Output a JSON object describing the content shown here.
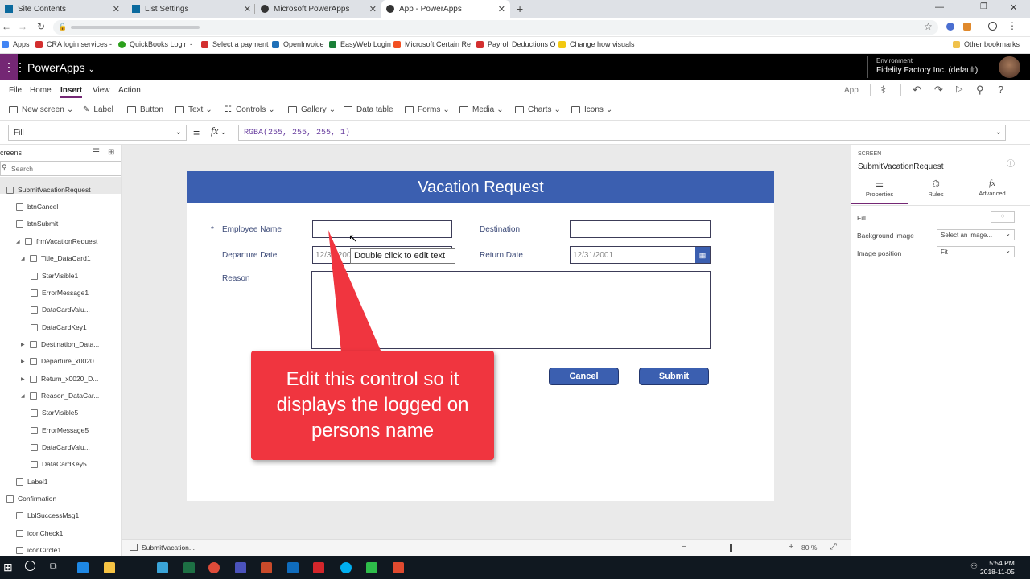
{
  "browser": {
    "tabs": [
      {
        "label": "Site Contents",
        "active": false
      },
      {
        "label": "List Settings",
        "active": false
      },
      {
        "label": "Microsoft PowerApps",
        "active": false
      },
      {
        "label": "App - PowerApps",
        "active": true
      }
    ],
    "bookmarks": [
      "Apps",
      "CRA login services -",
      "QuickBooks Login -",
      "Select a payment",
      "OpenInvoice",
      "EasyWeb Login",
      "Microsoft Certain Re",
      "Payroll Deductions O",
      "Change how visuals"
    ],
    "other_bookmarks": "Other bookmarks"
  },
  "header": {
    "app_name": "PowerApps",
    "env_label": "Environment",
    "env_name": "Fidelity Factory Inc. (default)"
  },
  "menu": {
    "items": [
      "File",
      "Home",
      "Insert",
      "View",
      "Action"
    ],
    "active": "Insert",
    "app_label": "App"
  },
  "toolbar": [
    "New screen",
    "Label",
    "Button",
    "Text",
    "Controls",
    "Gallery",
    "Data table",
    "Forms",
    "Media",
    "Charts",
    "Icons"
  ],
  "formula": {
    "property": "Fill",
    "equals": "=",
    "fx": "fx",
    "value": "RGBA(255, 255, 255, 1)"
  },
  "tree": {
    "title": "creens",
    "search_placeholder": "Search",
    "nodes": [
      {
        "label": "SubmitVacationRequest",
        "depth": 0,
        "selected": true
      },
      {
        "label": "btnCancel",
        "depth": 1
      },
      {
        "label": "btnSubmit",
        "depth": 1
      },
      {
        "label": "frmVacationRequest",
        "depth": 1,
        "expanded": true
      },
      {
        "label": "Title_DataCard1",
        "depth": 2,
        "expanded": true
      },
      {
        "label": "StarVisible1",
        "depth": 3
      },
      {
        "label": "ErrorMessage1",
        "depth": 3
      },
      {
        "label": "DataCardValu...",
        "depth": 3
      },
      {
        "label": "DataCardKey1",
        "depth": 3
      },
      {
        "label": "Destination_Data...",
        "depth": 2
      },
      {
        "label": "Departure_x0020...",
        "depth": 2
      },
      {
        "label": "Return_x0020_D...",
        "depth": 2
      },
      {
        "label": "Reason_DataCar...",
        "depth": 2,
        "expanded": true
      },
      {
        "label": "StarVisible5",
        "depth": 3
      },
      {
        "label": "ErrorMessage5",
        "depth": 3
      },
      {
        "label": "DataCardValu...",
        "depth": 3
      },
      {
        "label": "DataCardKey5",
        "depth": 3
      },
      {
        "label": "Label1",
        "depth": 1
      },
      {
        "label": "Confirmation",
        "depth": 0
      },
      {
        "label": "LblSuccessMsg1",
        "depth": 1
      },
      {
        "label": "iconCheck1",
        "depth": 1
      },
      {
        "label": "iconCircle1",
        "depth": 1
      }
    ]
  },
  "form": {
    "title": "Vacation Request",
    "required_star": "*",
    "employee_name_label": "Employee Name",
    "destination_label": "Destination",
    "departure_label": "Departure Date",
    "departure_value": "12/31/200",
    "return_label": "Return Date",
    "return_value": "12/31/2001",
    "reason_label": "Reason",
    "cancel_label": "Cancel",
    "submit_label": "Submit",
    "tooltip": "Double click to edit text"
  },
  "callout": {
    "text": "Edit this control so it displays the logged on persons name",
    "color": "#f0353f"
  },
  "bottom": {
    "screen_name": "SubmitVacation...",
    "zoom": "80 %",
    "minus": "−",
    "plus": "+"
  },
  "rightpanel": {
    "section": "SCREEN",
    "screen_name": "SubmitVacationRequest",
    "tabs": [
      "Properties",
      "Rules",
      "Advanced"
    ],
    "fill_label": "Fill",
    "bg_image_label": "Background image",
    "bg_image_value": "Select an image...",
    "image_pos_label": "Image position",
    "image_pos_value": "Fit"
  },
  "clock": {
    "time": "5:54 PM",
    "date": "2018-11-05"
  },
  "colors": {
    "accent": "#742774",
    "form_header": "#3b5fb0",
    "callout": "#f0353f"
  }
}
